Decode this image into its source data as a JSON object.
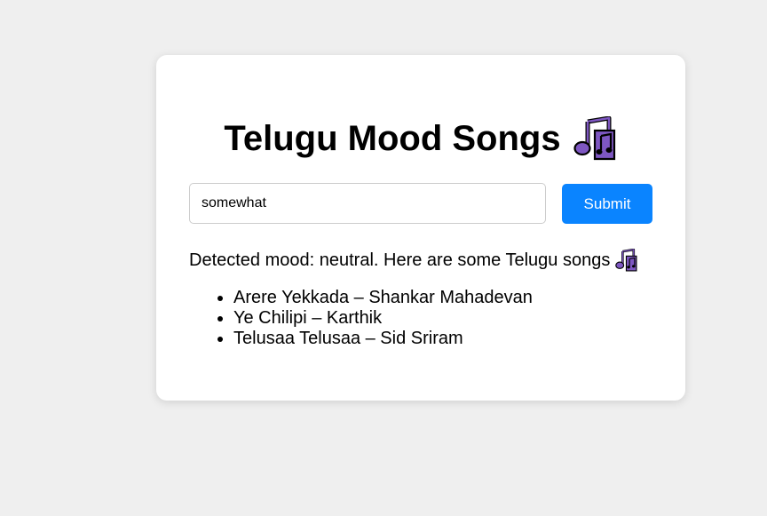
{
  "app": {
    "title": "Telugu Mood Songs",
    "title_icon": "musical-notes-icon"
  },
  "form": {
    "input_value": "somewhat",
    "submit_label": "Submit"
  },
  "result": {
    "message": "Detected mood: neutral. Here are some Telugu songs",
    "message_icon": "musical-notes-icon",
    "songs": [
      "Arere Yekkada – Shankar Mahadevan",
      "Ye Chilipi – Karthik",
      "Telusaa Telusaa – Sid Sriram"
    ]
  },
  "colors": {
    "background": "#efefef",
    "card": "#ffffff",
    "accent": "#0a84ff",
    "icon": "#7e57c2"
  }
}
